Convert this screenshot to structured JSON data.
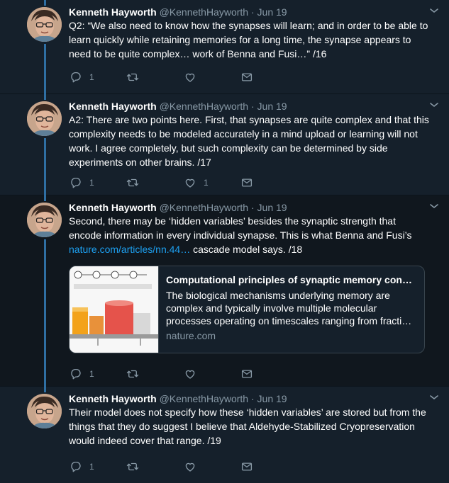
{
  "tweets": [
    {
      "name": "Kenneth Hayworth",
      "handle": "@KennethHayworth",
      "dot": "·",
      "date": "Jun 19",
      "text": "Q2: “We also need to know how the synapses will learn; and in order to be able to learn quickly while retaining memories for a long time, the synapse appears to need to be quite complex… work of Benna and Fusi…” /16",
      "reply_count": "1",
      "retweet_count": "",
      "like_count": ""
    },
    {
      "name": "Kenneth Hayworth",
      "handle": "@KennethHayworth",
      "dot": "·",
      "date": "Jun 19",
      "text": "A2: There are two points here. First, that synapses are quite complex and that this complexity needs to be modeled accurately in a mind upload or learning will not work. I agree completely, but such complexity can be determined by side experiments on other brains. /17",
      "reply_count": "1",
      "retweet_count": "",
      "like_count": "1"
    },
    {
      "name": "Kenneth Hayworth",
      "handle": "@KennethHayworth",
      "dot": "·",
      "date": "Jun 19",
      "text_before_link": "Second, there may be ‘hidden variables’ besides the synaptic strength that encode information in every individual synapse. This is what Benna and Fusi’s ",
      "link": "nature.com/articles/nn.44…",
      "text_after_link": " cascade model says. /18",
      "card": {
        "title": "Computational principles of synaptic memory con…",
        "description": "The biological mechanisms underlying memory are complex and typically involve multiple molecular processes operating on timescales ranging from fracti…",
        "domain": "nature.com"
      },
      "reply_count": "1",
      "retweet_count": "",
      "like_count": ""
    },
    {
      "name": "Kenneth Hayworth",
      "handle": "@KennethHayworth",
      "dot": "·",
      "date": "Jun 19",
      "text": "Their model does not specify how these ‘hidden variables’ are stored but from the things that they do suggest I believe that Aldehyde-Stabilized Cryopreservation would indeed cover that range. /19",
      "reply_count": "1",
      "retweet_count": "",
      "like_count": ""
    }
  ],
  "icons": {
    "reply": "reply-icon",
    "retweet": "retweet-icon",
    "like": "heart-icon",
    "dm": "envelope-icon",
    "menu": "chevron-down-icon"
  },
  "colors": {
    "background": "#15202b",
    "highlight_background": "#10171e",
    "thread_line": "#2f6fa3",
    "secondary_text": "#8899a6",
    "link": "#1da1f2",
    "card_border": "#38444d"
  }
}
